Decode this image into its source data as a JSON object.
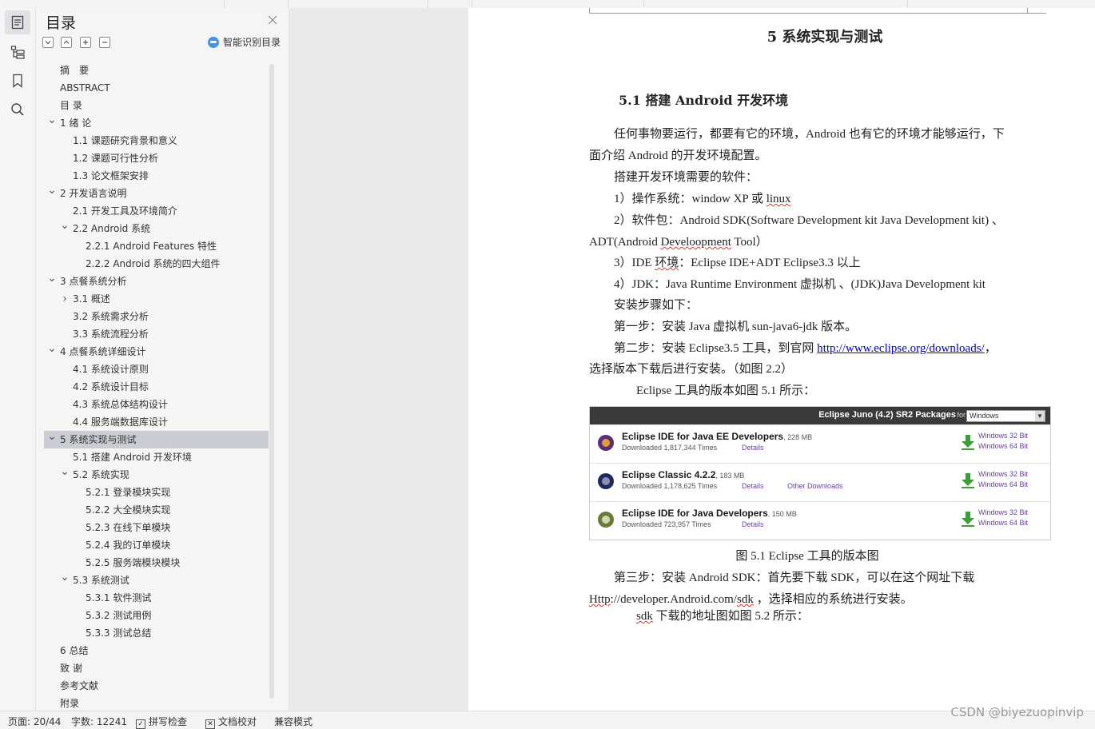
{
  "toc": {
    "title": "目录",
    "smart_label": "智能识别目录",
    "items": [
      {
        "label": "摘　要",
        "level": 0,
        "chevron": ""
      },
      {
        "label": "ABSTRACT",
        "level": 0,
        "chevron": ""
      },
      {
        "label": "目 录",
        "level": 0,
        "chevron": ""
      },
      {
        "label": "1 绪 论",
        "level": 0,
        "chevron": "v"
      },
      {
        "label": "1.1 课题研究背景和意义",
        "level": 1,
        "chevron": ""
      },
      {
        "label": "1.2 课题可行性分析",
        "level": 1,
        "chevron": ""
      },
      {
        "label": "1.3 论文框架安排",
        "level": 1,
        "chevron": ""
      },
      {
        "label": "2 开发语言说明",
        "level": 0,
        "chevron": "v"
      },
      {
        "label": "2.1 开发工具及环境简介",
        "level": 1,
        "chevron": ""
      },
      {
        "label": "2.2 Android 系统",
        "level": 1,
        "chevron": "v"
      },
      {
        "label": "2.2.1 Android Features 特性",
        "level": 2,
        "chevron": ""
      },
      {
        "label": "2.2.2 Android 系统的四大组件",
        "level": 2,
        "chevron": ""
      },
      {
        "label": "3 点餐系统分析",
        "level": 0,
        "chevron": "v"
      },
      {
        "label": "3.1 概述",
        "level": 1,
        "chevron": ">"
      },
      {
        "label": "3.2 系统需求分析",
        "level": 1,
        "chevron": ""
      },
      {
        "label": "3.3 系统流程分析",
        "level": 1,
        "chevron": ""
      },
      {
        "label": "4 点餐系统详细设计",
        "level": 0,
        "chevron": "v"
      },
      {
        "label": "4.1 系统设计原则",
        "level": 1,
        "chevron": ""
      },
      {
        "label": "4.2 系统设计目标",
        "level": 1,
        "chevron": ""
      },
      {
        "label": "4.3 系统总体结构设计",
        "level": 1,
        "chevron": ""
      },
      {
        "label": "4.4 服务端数据库设计",
        "level": 1,
        "chevron": ""
      },
      {
        "label": "5 系统实现与测试",
        "level": 0,
        "chevron": "v",
        "selected": true
      },
      {
        "label": "5.1 搭建 Android 开发环境",
        "level": 1,
        "chevron": ""
      },
      {
        "label": "5.2 系统实现",
        "level": 1,
        "chevron": "v"
      },
      {
        "label": "5.2.1 登录模块实现",
        "level": 2,
        "chevron": ""
      },
      {
        "label": "5.2.2 大全模块实现",
        "level": 2,
        "chevron": ""
      },
      {
        "label": "5.2.3 在线下单模块",
        "level": 2,
        "chevron": ""
      },
      {
        "label": "5.2.4 我的订单模块",
        "level": 2,
        "chevron": ""
      },
      {
        "label": "5.2.5 服务端模块模块",
        "level": 2,
        "chevron": ""
      },
      {
        "label": "5.3 系统测试",
        "level": 1,
        "chevron": "v"
      },
      {
        "label": "5.3.1 软件测试",
        "level": 2,
        "chevron": ""
      },
      {
        "label": "5.3.2 测试用例",
        "level": 2,
        "chevron": ""
      },
      {
        "label": "5.3.3 测试总结",
        "level": 2,
        "chevron": ""
      },
      {
        "label": "6 总结",
        "level": 0,
        "chevron": ""
      },
      {
        "label": "致 谢",
        "level": 0,
        "chevron": ""
      },
      {
        "label": "参考文献",
        "level": 0,
        "chevron": ""
      },
      {
        "label": "附录",
        "level": 0,
        "chevron": ""
      }
    ]
  },
  "doc": {
    "chapter_title": "5 系统实现与测试",
    "section_title": "5.1 搭建 Android 开发环境",
    "para1_line1": "任何事物要运行，都要有它的环境，Android 也有它的环境才能够运行，下",
    "para1_line2": "面介绍 Android 的开发环境配置。",
    "para2": "搭建开发环境需要的软件：",
    "item1_pre": "1）操作系统：window XP 或 ",
    "item1_word": "linux",
    "item2_line1": "2）软件包：Android SDK(Software Development kit Java Development kit) 、",
    "item2_pre": "ADT(Android ",
    "item2_word": "Develoopment",
    "item2_post": " Tool）",
    "item3_pre": "3）IDE ",
    "item3_word": "环境",
    "item3_post": "：Eclipse IDE+ADT Eclipse3.3 以上",
    "item4": "4）JDK：Java Runtime Environment 虚拟机 、(JDK)Java Development kit",
    "steps_intro": "安装步骤如下：",
    "step1": "第一步：安装 Java 虚拟机 sun-java6-jdk 版本。",
    "step2_pre": "第二步：安装 Eclipse3.5 工具，到官网 ",
    "step2_link": "http://www.eclipse.org/downloads/",
    "step2_post": "，",
    "step2_line2": "选择版本下载后进行安装。（如图 2.2）",
    "fig_intro": "Eclipse 工具的版本如图 5.1 所示：",
    "fig_caption": "图 5.1 Eclipse 工具的版本图",
    "step3_line1": "第三步：安装 Android SDK：首先要下载 SDK，可以在这个网址下载",
    "step3_url_a": "Http",
    "step3_url_b": "://developer.Android.com/",
    "step3_url_c": "sdk",
    "step3_line2_post": " ，选择相应的系统进行安装。",
    "sdk_word": "sdk",
    "sdk_post": " 下载的地址图如图 5.2 所示："
  },
  "figure": {
    "header": "Eclipse Juno (4.2) SR2 Packages",
    "for_label": "for",
    "select_value": "Windows",
    "rows": [
      {
        "name": "Eclipse IDE for Java EE Developers",
        "size": ", 228 MB",
        "downloads": "Downloaded 1,817,344 Times",
        "details": "Details",
        "other": "",
        "w32": "Windows 32 Bit",
        "w64": "Windows 64 Bit"
      },
      {
        "name": "Eclipse Classic 4.2.2",
        "size": ", 183 MB",
        "downloads": "Downloaded 1,178,625 Times",
        "details": "Details",
        "other": "Other Downloads",
        "w32": "Windows 32 Bit",
        "w64": "Windows 64 Bit"
      },
      {
        "name": "Eclipse IDE for Java Developers",
        "size": ", 150 MB",
        "downloads": "Downloaded 723,957 Times",
        "details": "Details",
        "other": "",
        "w32": "Windows 32 Bit",
        "w64": "Windows 64 Bit"
      }
    ]
  },
  "status": {
    "page": "页面: 20/44",
    "words": "字数: 12241",
    "spell": "拼写检查",
    "proof": "文档校对",
    "compat": "兼容模式"
  },
  "watermark": "CSDN @biyezuopinvip",
  "colors": {
    "selected_row": "#c9cdd3",
    "link": "#0000cc",
    "figure_header": "#3a3a3a",
    "download_green": "#3aa035"
  }
}
